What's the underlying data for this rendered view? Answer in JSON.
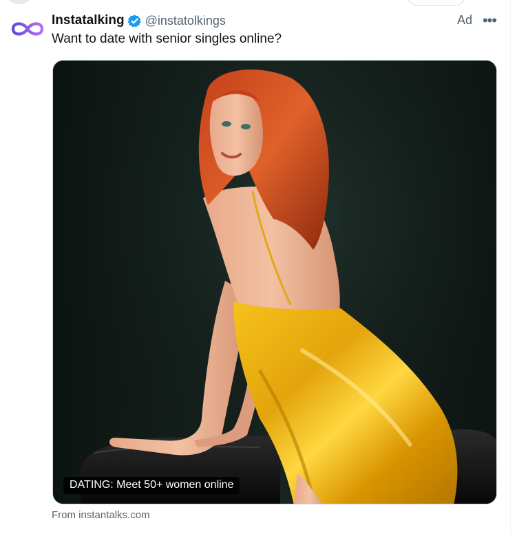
{
  "tweet": {
    "display_name": "Instatalking",
    "handle": "@instatolkings",
    "ad_label": "Ad",
    "more_label": "•••",
    "text": "Want to date with senior singles online?",
    "verified": true,
    "avatar_icon": "infinity-logo-icon",
    "verified_icon": "verified-badge-icon",
    "colors": {
      "verified": "#1d9bf0",
      "name": "#0f1419",
      "muted": "#536471",
      "avatar_gradient": [
        "#5b4bdb",
        "#b86cf0"
      ]
    }
  },
  "card": {
    "image_alt": "Red-haired woman in a gold satin slip dress posing on a black leather sofa",
    "promo_label": "DATING: Meet 50+ women online",
    "source": "From instantalks.com"
  }
}
